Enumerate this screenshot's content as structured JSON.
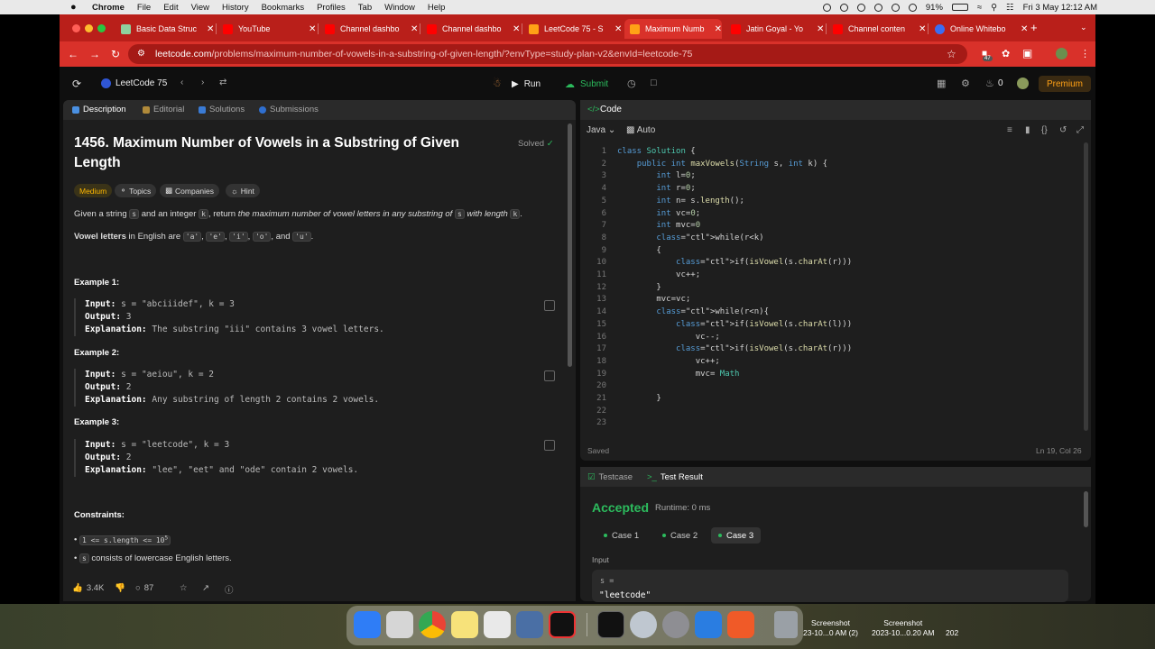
{
  "menubar": {
    "app": "Chrome",
    "items": [
      "File",
      "Edit",
      "View",
      "History",
      "Bookmarks",
      "Profiles",
      "Tab",
      "Window",
      "Help"
    ],
    "battery": "91%",
    "datetime": "Fri 3 May  12:12 AM"
  },
  "browser": {
    "tabs": [
      {
        "title": "Basic Data Struc",
        "favicon_color": "#8fd19e"
      },
      {
        "title": "YouTube",
        "favicon_color": "#ff0000"
      },
      {
        "title": "Channel dashbo",
        "favicon_color": "#ff0000"
      },
      {
        "title": "Channel dashbo",
        "favicon_color": "#ff0000"
      },
      {
        "title": "LeetCode 75 - S",
        "favicon_color": "#ffa116"
      },
      {
        "title": "Maximum Numb",
        "favicon_color": "#ffa116"
      },
      {
        "title": "Jatin Goyal - Yo",
        "favicon_color": "#ff0000"
      },
      {
        "title": "Channel conten",
        "favicon_color": "#ff0000"
      },
      {
        "title": "Online Whitebo",
        "favicon_color": "#3b6df2"
      }
    ],
    "active_tab_index": 5,
    "new_tab_label": "+",
    "url_host": "leetcode.com",
    "url_path": "/problems/maximum-number-of-vowels-in-a-substring-of-given-length/?envType=study-plan-v2&envId=leetcode-75",
    "extension_badge": "47"
  },
  "leetcode": {
    "study_plan": "LeetCode 75",
    "run_label": "Run",
    "submit_label": "Submit",
    "streak_count": "0",
    "premium_label": "Premium",
    "accent": "#ffa116",
    "success_color": "#2cbb5d"
  },
  "left_panel": {
    "tabs": [
      "Description",
      "Editorial",
      "Solutions",
      "Submissions"
    ],
    "title": "1456. Maximum Number of Vowels in a Substring of Given Length",
    "solved_label": "Solved",
    "chips": [
      "Medium",
      "Topics",
      "Companies",
      "Hint"
    ],
    "desc_1_pre": "Given a string ",
    "desc_1_s": "s",
    "desc_1_mid": " and an integer ",
    "desc_1_k": "k",
    "desc_1_post": ", return ",
    "desc_1_em": "the maximum number of vowel letters in any substring of ",
    "desc_1_s2": "s",
    "desc_1_em2": " with length ",
    "desc_1_k2": "k",
    "desc_1_end": ".",
    "vowel_bold": "Vowel letters",
    "vowel_text": " in English are ",
    "vowels": [
      "'a'",
      "'e'",
      "'i'",
      "'o'",
      "'u'"
    ],
    "and_label": "and",
    "examples": [
      {
        "title": "Example 1:",
        "input": "s = \"abciiidef\", k = 3",
        "output": "3",
        "explanation": "The substring \"iii\" contains 3 vowel letters."
      },
      {
        "title": "Example 2:",
        "input": "s = \"aeiou\", k = 2",
        "output": "2",
        "explanation": "Any substring of length 2 contains 2 vowels."
      },
      {
        "title": "Example 3:",
        "input": "s = \"leetcode\", k = 3",
        "output": "2",
        "explanation": "\"lee\", \"eet\" and \"ode\" contain 2 vowels."
      }
    ],
    "input_label": "Input:",
    "output_label": "Output:",
    "explanation_label": "Explanation:",
    "constraints_title": "Constraints:",
    "constraint_1": "1 <= s.length <= 10",
    "constraint_1_sup": "5",
    "constraint_2_code": "s",
    "constraint_2_text": " consists of lowercase English letters.",
    "likes": "3.4K",
    "comments": "87"
  },
  "code_panel": {
    "title": "Code",
    "language": "Java",
    "mode": "Auto",
    "lines": [
      "class Solution {",
      "    public int maxVowels(String s, int k) {",
      "        int l=0;",
      "        int r=0;",
      "        int n= s.length();",
      "        int vc=0;",
      "        int mvc=0",
      "        while(r<k)",
      "        {",
      "            if(isVowel(s.charAt(r)))",
      "            vc++;",
      "        }",
      "        mvc=vc;",
      "        while(r<n){",
      "            if(isVowel(s.charAt(l)))",
      "                vc--;",
      "            if(isVowel(s.charAt(r)))",
      "                vc++;",
      "                mvc= Math",
      "",
      "        }",
      "",
      ""
    ],
    "status": "Saved",
    "cursor": "Ln 19, Col 26"
  },
  "result_panel": {
    "tabs": [
      "Testcase",
      "Test Result"
    ],
    "verdict": "Accepted",
    "runtime": "Runtime: 0 ms",
    "cases": [
      "Case 1",
      "Case 2",
      "Case 3"
    ],
    "active_case_index": 2,
    "input_label": "Input",
    "input_var": "s =",
    "input_value": "\"leetcode\""
  },
  "dock": {
    "screenshots": [
      {
        "title": "Screenshot",
        "subtitle": "23-10...0 AM (2)"
      },
      {
        "title": "Screenshot",
        "subtitle": "2023-10...0.20 AM"
      }
    ],
    "trailing": "202"
  }
}
